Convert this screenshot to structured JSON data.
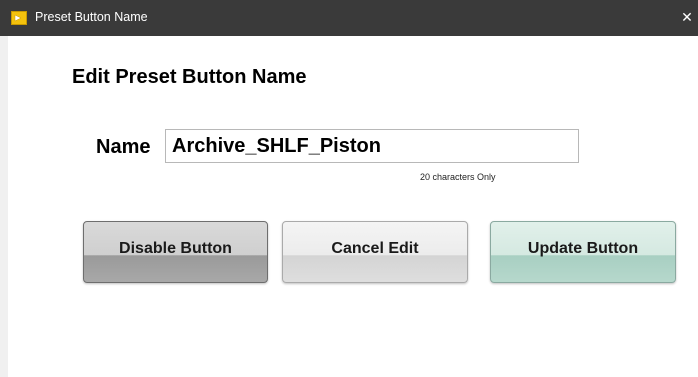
{
  "window": {
    "title": "Preset Button Name",
    "close_glyph": "✕"
  },
  "dialog": {
    "heading": "Edit Preset Button Name",
    "name_label": "Name",
    "name_value": "Archive_SHLF_Piston",
    "hint": "20 characters Only"
  },
  "buttons": {
    "disable_label": "Disable Button",
    "cancel_label": "Cancel Edit",
    "update_label": "Update Button"
  },
  "colors": {
    "titlebar": "#3a3a3a",
    "disable_button": "#a8a8a8",
    "cancel_button": "#e6e6e6",
    "update_button": "#b6d8cc"
  },
  "icons": {
    "app": "labview-app-icon",
    "close": "close-icon"
  }
}
